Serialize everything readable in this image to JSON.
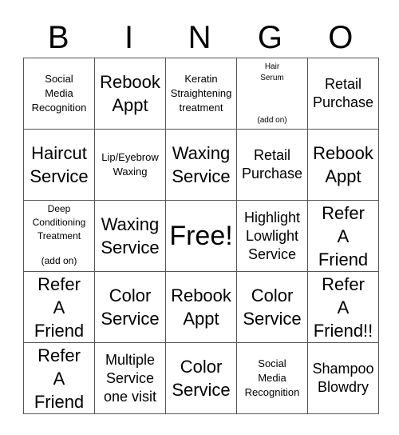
{
  "header": [
    "B",
    "I",
    "N",
    "G",
    "O"
  ],
  "rows": [
    [
      {
        "lines": [
          "Social",
          "Media",
          "Recognition"
        ],
        "size": "sm"
      },
      {
        "lines": [
          "Rebook",
          "Appt"
        ],
        "size": "lg"
      },
      {
        "lines": [
          "Keratin",
          "Straightening",
          "treatment"
        ],
        "size": "sm"
      },
      {
        "lines": [
          "Hair",
          "Serum"
        ],
        "note": "(add on)",
        "size": "xs"
      },
      {
        "lines": [
          "Retail",
          "Purchase"
        ],
        "size": "md"
      }
    ],
    [
      {
        "lines": [
          "Haircut",
          "Service"
        ],
        "size": "lg"
      },
      {
        "lines": [
          "Lip/Eyebrow",
          "Waxing"
        ],
        "size": "sm"
      },
      {
        "lines": [
          "Waxing",
          "Service"
        ],
        "size": "lg"
      },
      {
        "lines": [
          "Retail",
          "Purchase"
        ],
        "size": "md"
      },
      {
        "lines": [
          "Rebook",
          "Appt"
        ],
        "size": "lg"
      }
    ],
    [
      {
        "lines": [
          "Deep",
          "Conditioning",
          "Treatment"
        ],
        "note": "(add on)",
        "size": "sm"
      },
      {
        "lines": [
          "Waxing",
          "Service"
        ],
        "size": "lg"
      },
      {
        "lines": [
          "Free!"
        ],
        "size": "free"
      },
      {
        "lines": [
          "Highlight",
          "Lowlight",
          "Service"
        ],
        "size": "md"
      },
      {
        "lines": [
          "Refer",
          "A",
          "Friend"
        ],
        "size": "lg"
      }
    ],
    [
      {
        "lines": [
          "Refer",
          "A",
          "Friend"
        ],
        "size": "lg"
      },
      {
        "lines": [
          "Color",
          "Service"
        ],
        "size": "lg"
      },
      {
        "lines": [
          "Rebook",
          "Appt"
        ],
        "size": "lg"
      },
      {
        "lines": [
          "Color",
          "Service"
        ],
        "size": "lg"
      },
      {
        "lines": [
          "Refer",
          "A",
          "Friend!!"
        ],
        "size": "lg"
      }
    ],
    [
      {
        "lines": [
          "Refer",
          "A",
          "Friend"
        ],
        "size": "lg"
      },
      {
        "lines": [
          "Multiple",
          "Service",
          "one visit"
        ],
        "size": "md"
      },
      {
        "lines": [
          "Color",
          "Service"
        ],
        "size": "lg"
      },
      {
        "lines": [
          "Social",
          "Media",
          "Recognition"
        ],
        "size": "sm"
      },
      {
        "lines": [
          "Shampoo",
          "Blowdry"
        ],
        "size": "md"
      }
    ]
  ]
}
